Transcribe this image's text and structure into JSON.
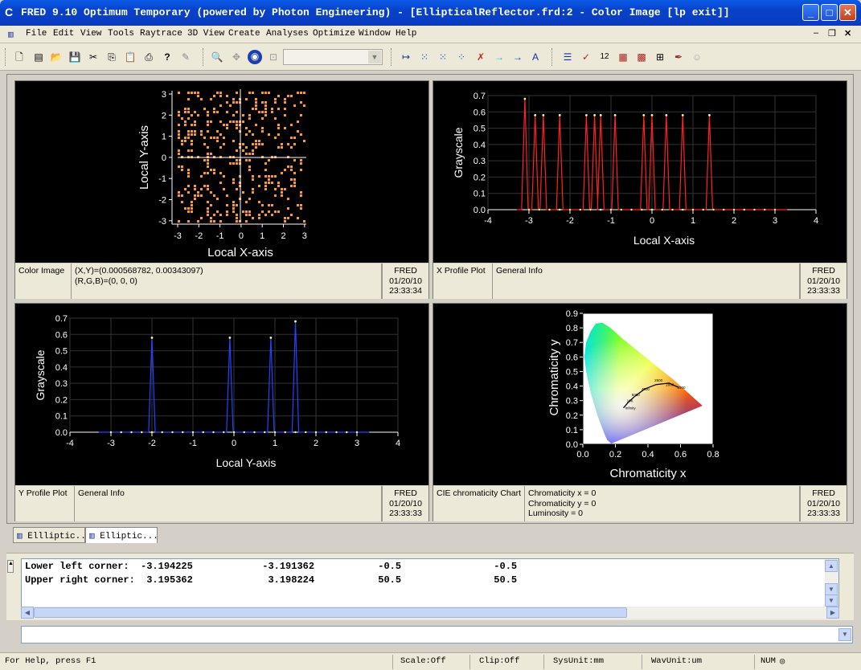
{
  "window": {
    "title": "FRED 9.10 Optimum Temporary (powered by Photon Engineering) - [EllipticalReflector.frd:2 - Color Image   [lp exit]]",
    "app_icon": "C"
  },
  "menu": [
    "File",
    "Edit",
    "View",
    "Tools",
    "Raytrace",
    "3D View",
    "Create",
    "Analyses",
    "Optimize",
    "Window",
    "Help"
  ],
  "panels": {
    "color_image": {
      "xlabel": "Local X-axis",
      "ylabel": "Local Y-axis",
      "xticks": [
        "-3",
        "-2",
        "-1",
        "0",
        "1",
        "2",
        "3"
      ],
      "yticks": [
        "3",
        "2",
        "1",
        "0",
        "-1",
        "-2",
        "-3"
      ],
      "info_name": "Color Image",
      "info_line1": "(X,Y)=(0.000568782, 0.00343097)",
      "info_line2": "(R,G,B)=(0, 0, 0)",
      "app": "FRED",
      "date": "01/20/10",
      "time": "23:33:34",
      "dot_color": "#ff9922"
    },
    "x_profile": {
      "xlabel": "Local X-axis",
      "ylabel": "Grayscale",
      "info_name": "X Profile Plot",
      "info_general": "General Info",
      "app": "FRED",
      "date": "01/20/10",
      "time": "23:33:33"
    },
    "y_profile": {
      "xlabel": "Local Y-axis",
      "ylabel": "Grayscale",
      "info_name": "Y Profile Plot",
      "info_general": "General Info",
      "app": "FRED",
      "date": "01/20/10",
      "time": "23:33:33"
    },
    "cie": {
      "xlabel": "Chromaticity x",
      "ylabel": "Chromaticity y",
      "xticks": [
        "0.0",
        "0.2",
        "0.4",
        "0.6",
        "0.8"
      ],
      "yticks": [
        "0.9",
        "0.8",
        "0.7",
        "0.6",
        "0.5",
        "0.4",
        "0.3",
        "0.2",
        "0.1",
        "0.0"
      ],
      "locus_labels": [
        "1500",
        "2000",
        "2500",
        "4000",
        "6000",
        "10K",
        "Infinity"
      ],
      "info_name": "CIE chromaticity Chart",
      "info_line1": "Chromaticity x = 0",
      "info_line2": "Chromaticity y = 0",
      "info_line3": "Luminosity = 0",
      "app": "FRED",
      "date": "01/20/10",
      "time": "23:33:33"
    }
  },
  "chart_data": [
    {
      "type": "line",
      "xlabel": "Local X-axis",
      "ylabel": "Grayscale",
      "xlim": [
        -4,
        4
      ],
      "ylim": [
        0,
        0.7
      ],
      "xticks": [
        -4,
        -3,
        -2,
        -1,
        0,
        1,
        2,
        3,
        4
      ],
      "yticks": [
        0.0,
        0.1,
        0.2,
        0.3,
        0.4,
        0.5,
        0.6,
        0.7
      ],
      "color": "#ff2222",
      "peaks": [
        {
          "x": -3.1,
          "y": 0.68
        },
        {
          "x": -2.85,
          "y": 0.58
        },
        {
          "x": -2.65,
          "y": 0.58
        },
        {
          "x": -2.25,
          "y": 0.58
        },
        {
          "x": -1.6,
          "y": 0.58
        },
        {
          "x": -1.4,
          "y": 0.58
        },
        {
          "x": -1.25,
          "y": 0.58
        },
        {
          "x": -0.9,
          "y": 0.58
        },
        {
          "x": -0.2,
          "y": 0.58
        },
        {
          "x": 0.0,
          "y": 0.58
        },
        {
          "x": 0.35,
          "y": 0.58
        },
        {
          "x": 0.75,
          "y": 0.58
        },
        {
          "x": 1.4,
          "y": 0.58
        }
      ],
      "grid": true
    },
    {
      "type": "line",
      "xlabel": "Local Y-axis",
      "ylabel": "Grayscale",
      "xlim": [
        -4,
        4
      ],
      "ylim": [
        0,
        0.7
      ],
      "xticks": [
        -4,
        -3,
        -2,
        -1,
        0,
        1,
        2,
        3,
        4
      ],
      "yticks": [
        0.0,
        0.1,
        0.2,
        0.3,
        0.4,
        0.5,
        0.6,
        0.7
      ],
      "color": "#2244ff",
      "peaks": [
        {
          "x": -2.0,
          "y": 0.58
        },
        {
          "x": -0.1,
          "y": 0.58
        },
        {
          "x": 0.9,
          "y": 0.58
        },
        {
          "x": 1.5,
          "y": 0.68
        }
      ],
      "grid": true
    }
  ],
  "doc_tabs": [
    "Ellliptic...",
    "Elliptic..."
  ],
  "output": {
    "line1": "Lower left corner:  -3.194225            -3.191362           -0.5                -0.5",
    "line2": "Upper right corner:  3.195362             3.198224           50.5                50.5"
  },
  "status": {
    "help": "For Help, press F1",
    "scale": "Scale:Off",
    "clip": "Clip:Off",
    "sysunit": "SysUnit:mm",
    "wavunit": "WavUnit:um",
    "num": "NUM"
  }
}
